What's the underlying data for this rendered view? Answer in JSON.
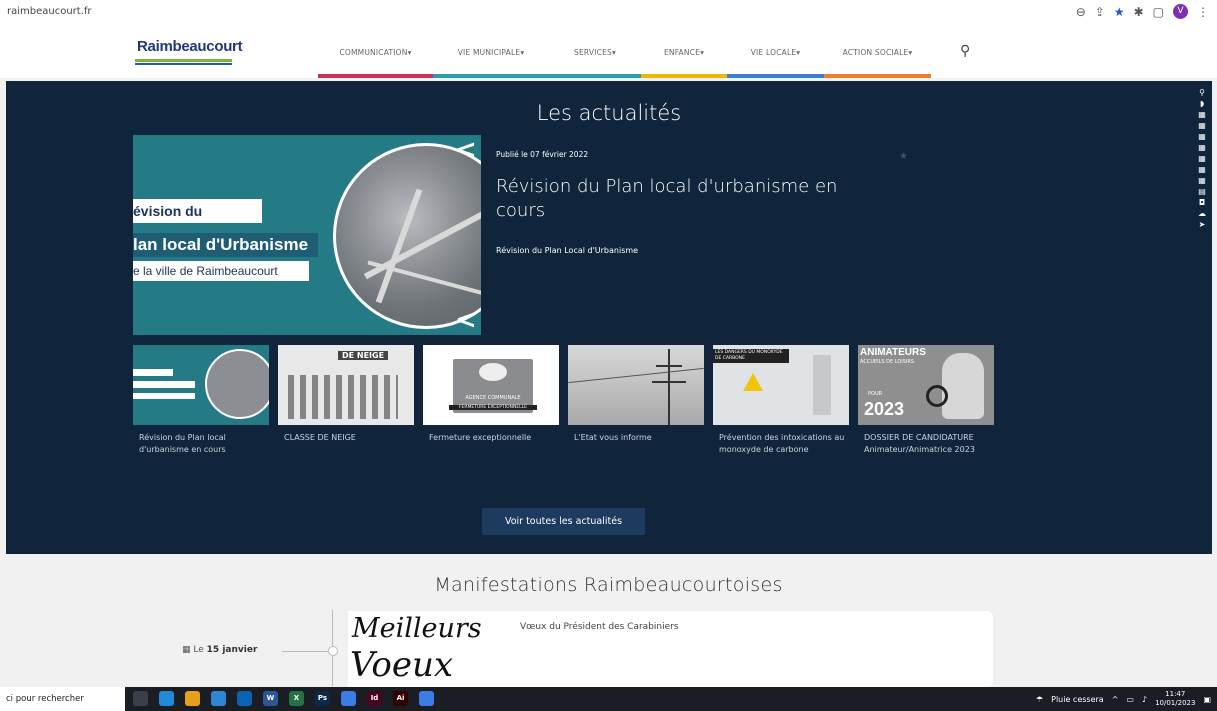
{
  "browser": {
    "url": "raimbeaucourt.fr",
    "profile_initial": "V"
  },
  "site": {
    "logo_text": "Raimbeaucourt"
  },
  "nav": {
    "items": [
      {
        "label": "COMMUNICATION",
        "color": "#c8315a"
      },
      {
        "label": "VIE MUNICIPALE",
        "color": "#2a9db0"
      },
      {
        "label": "SERVICES",
        "color": "#2a9db0"
      },
      {
        "label": "ENFANCE",
        "color": "#f2b705"
      },
      {
        "label": "VIE LOCALE",
        "color": "#3a7fd0"
      },
      {
        "label": "ACTION SOCIALE",
        "color": "#f07d2c"
      }
    ],
    "dropdown_icon": "caret-down-icon",
    "search_icon": "search-icon"
  },
  "news": {
    "title": "Les actualités",
    "featured": {
      "image_text": {
        "line1": "évision du",
        "line2": "lan local d'Urbanisme",
        "line3": "e la ville de Raimbeaucourt"
      },
      "published": "Publié le 07 février 2022",
      "headline": "Révision du Plan local d'urbanisme en cours",
      "summary": "Révision du Plan Local d'Urbanisme"
    },
    "items": [
      {
        "caption": "Révision du Plan local d'urbanisme en cours"
      },
      {
        "caption": "CLASSE DE NEIGE",
        "image_text": "DE NEIGE"
      },
      {
        "caption": "Fermeture exceptionnelle",
        "image_text": "AGENCE COMMUNALE",
        "image_text2": "FERMETURE EXCEPTIONNELLE"
      },
      {
        "caption": "L'Etat vous informe"
      },
      {
        "caption": "Prévention des intoxications au monoxyde de carbone",
        "image_text": "LES DANGERS DU MONOXYDE DE CARBONE"
      },
      {
        "caption": "DOSSIER DE CANDIDATURE Animateur/Animatrice 2023",
        "image_text": "ANIMATEURS",
        "image_text2": "ACCUEILS DE LOISIRS",
        "image_text3": "POUR",
        "image_text4": "2023"
      }
    ],
    "all_button": "Voir toutes les actualités"
  },
  "events": {
    "title": "Manifestations Raimbeaucourtoises",
    "date_prefix": "Le",
    "date": "15 janvier",
    "card": {
      "image_text1": "Meilleurs",
      "image_text2": "Voeux",
      "title": "Vœux du Président des Carabiniers"
    }
  },
  "taskbar": {
    "search_placeholder": "ci pour rechercher",
    "weather": "Pluie cessera",
    "time": "11:47",
    "date": "10/01/2023",
    "apps": [
      {
        "label": "",
        "color": "#3a3f4b"
      },
      {
        "label": "",
        "color": "#1f8ad6"
      },
      {
        "label": "",
        "color": "#e6a119"
      },
      {
        "label": "",
        "color": "#2f86d6"
      },
      {
        "label": "",
        "color": "#0a64b4"
      },
      {
        "label": "W",
        "color": "#2b579a"
      },
      {
        "label": "X",
        "color": "#217346"
      },
      {
        "label": "Ps",
        "color": "#0b2a4a"
      },
      {
        "label": "",
        "color": "#3b7de6"
      },
      {
        "label": "Id",
        "color": "#49021f"
      },
      {
        "label": "Ai",
        "color": "#330000"
      },
      {
        "label": "",
        "color": "#3b7de6"
      }
    ]
  }
}
